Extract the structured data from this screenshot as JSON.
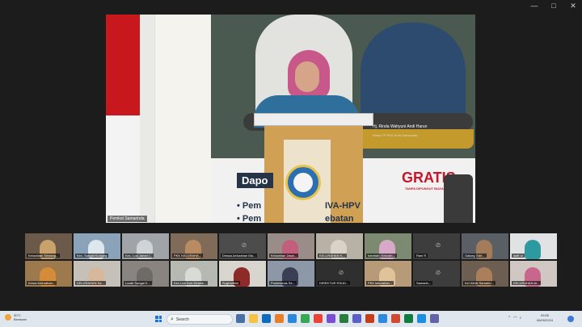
{
  "window": {
    "minimize": "—",
    "maximize": "□",
    "close": "✕"
  },
  "stage": {
    "speaker_label": "Pemkot Samarinda",
    "banner_caption": "Hj. Rinda Wahyuni Andi Harun",
    "banner_caption_sub": "Ketua TP PKK Kota Samarinda",
    "dapo": "Dapo",
    "gratis": "GRATIS",
    "gratis_sub": "TANPA DIPUNGUT BIAYA",
    "line1_a": "• Pem",
    "line1_b": "IVA-HPV",
    "line2_a": "• Pem",
    "line2_b": "ebatan"
  },
  "participants": [
    {
      "name": "Kelurahan Sindang...",
      "color": "#6b5a4a",
      "fig": "#c9a26b"
    },
    {
      "name": "Kec. Sungai Kunjang",
      "color": "#8aa3b8",
      "fig": "#dfe7ee"
    },
    {
      "name": "Kec. Loa Janan I...",
      "color": "#a0a3a8",
      "fig": "#cfd4d8"
    },
    {
      "name": "PKK KELURAHA...",
      "color": "#7f6b57",
      "fig": "#b98b62"
    },
    {
      "name": "Dinsos-kelurahan Ma...",
      "color": "#4c4c4c",
      "fig": null
    },
    {
      "name": "Kelurahan Jawa...",
      "color": "#9a8c86",
      "fig": "#c35e7d"
    },
    {
      "name": "KELURAHAN K...",
      "color": "#b7b1a6",
      "fig": "#d9d2c7"
    },
    {
      "name": "hamriah, Kelurah...",
      "color": "#7d8a72",
      "fig": "#d7a9c6"
    },
    {
      "name": "Rani R",
      "color": "#3d3d3d",
      "fig": null
    },
    {
      "name": "Galaxy, Edit...",
      "color": "#5a5f66",
      "fig": "#a37c5b"
    },
    {
      "name": "ladit ur",
      "color": "#e0e2e4",
      "fig": "#2c9aa0"
    },
    {
      "name": "Kesra Kelurahan...",
      "color": "#9c7a4e",
      "fig": "#d48c3a"
    },
    {
      "name": "KELURAHAN Sa...",
      "color": "#c5c0b8",
      "fig": "#d8b89a"
    },
    {
      "name": "Lurah Sungai K...",
      "color": "#8a8480",
      "fig": "#6e6a66"
    },
    {
      "name": "Kec Loa Duri-Dinkes...",
      "color": "#b6b8b2",
      "fig": "#d9dbd5"
    },
    {
      "name": "Sugharthini",
      "color": "#d8d4ce",
      "fig": "#8d2a2a"
    },
    {
      "name": "Puskesmas Se...",
      "color": "#8c98a8",
      "fig": "#3a3f55"
    },
    {
      "name": "DIREKTUR RSUD...",
      "color": "#2f2f2f",
      "fig": null
    },
    {
      "name": "PKK kelurahan...",
      "color": "#b79a78",
      "fig": "#e1c39a"
    },
    {
      "name": "Samarin...",
      "color": "#3d3d3d",
      "fig": null
    },
    {
      "name": "Kel Klinik Samarin...",
      "color": "#6d5e52",
      "fig": "#aa7f5c"
    },
    {
      "name": "KELURAHAN Ai...",
      "color": "#d0c6c2",
      "fig": "#c8678b"
    }
  ],
  "taskbar": {
    "temp": "30°C",
    "weather": "Berawan",
    "search_placeholder": "Search",
    "time": "09:55",
    "date": "06/09/2024",
    "apps": [
      "#4a6fa5",
      "#f5c242",
      "#0f6cbd",
      "#e87d2a",
      "#2b88d8",
      "#34a853",
      "#ea4335",
      "#7a4fd1",
      "#2a7d3e",
      "#5b5fc7",
      "#c43e1c",
      "#2d8ae0",
      "#d04a2f",
      "#107c41",
      "#1a8ee0",
      "#6264a7"
    ]
  }
}
